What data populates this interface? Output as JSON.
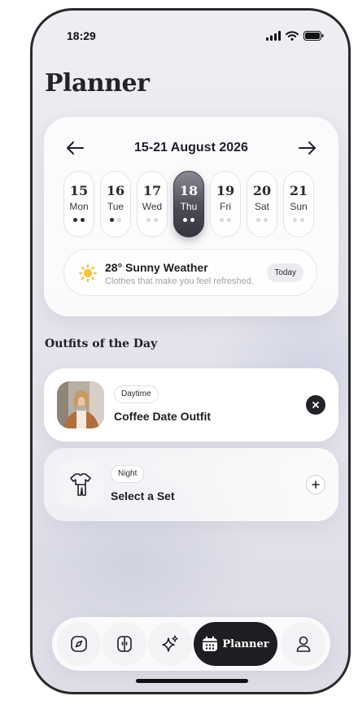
{
  "status_bar": {
    "time": "18:29"
  },
  "page": {
    "title": "Planner"
  },
  "week": {
    "range": "15-21 August 2026",
    "days": [
      {
        "num": "15",
        "name": "Mon",
        "dots": [
          true,
          true
        ],
        "selected": false
      },
      {
        "num": "16",
        "name": "Tue",
        "dots": [
          true,
          false
        ],
        "selected": false
      },
      {
        "num": "17",
        "name": "Wed",
        "dots": [
          false,
          false
        ],
        "selected": false
      },
      {
        "num": "18",
        "name": "Thu",
        "dots": [
          true,
          true
        ],
        "selected": true
      },
      {
        "num": "19",
        "name": "Fri",
        "dots": [
          false,
          false
        ],
        "selected": false
      },
      {
        "num": "20",
        "name": "Sat",
        "dots": [
          false,
          false
        ],
        "selected": false
      },
      {
        "num": "21",
        "name": "Sun",
        "dots": [
          false,
          false
        ],
        "selected": false
      }
    ]
  },
  "weather": {
    "icon": "sun-icon",
    "title": "28° Sunny Weather",
    "subtitle": "Clothes that make you feel refreshed.",
    "badge": "Today"
  },
  "outfits": {
    "section_title": "Outfits of the Day",
    "items": [
      {
        "time": "Daytime",
        "name": "Coffee Date Outfit",
        "action": "remove"
      },
      {
        "time": "Night",
        "name": "Select a Set",
        "action": "add"
      }
    ]
  },
  "tabbar": {
    "tabs": [
      {
        "icon": "compass-icon",
        "label": ""
      },
      {
        "icon": "wardrobe-icon",
        "label": ""
      },
      {
        "icon": "sparkles-icon",
        "label": ""
      },
      {
        "icon": "calendar-icon",
        "label": "Planner",
        "active": true
      },
      {
        "icon": "user-icon",
        "label": ""
      }
    ]
  },
  "colors": {
    "accent_dark": "#1e1e22",
    "selected_day": "#4c4c57",
    "background": "#e6e6ee"
  }
}
